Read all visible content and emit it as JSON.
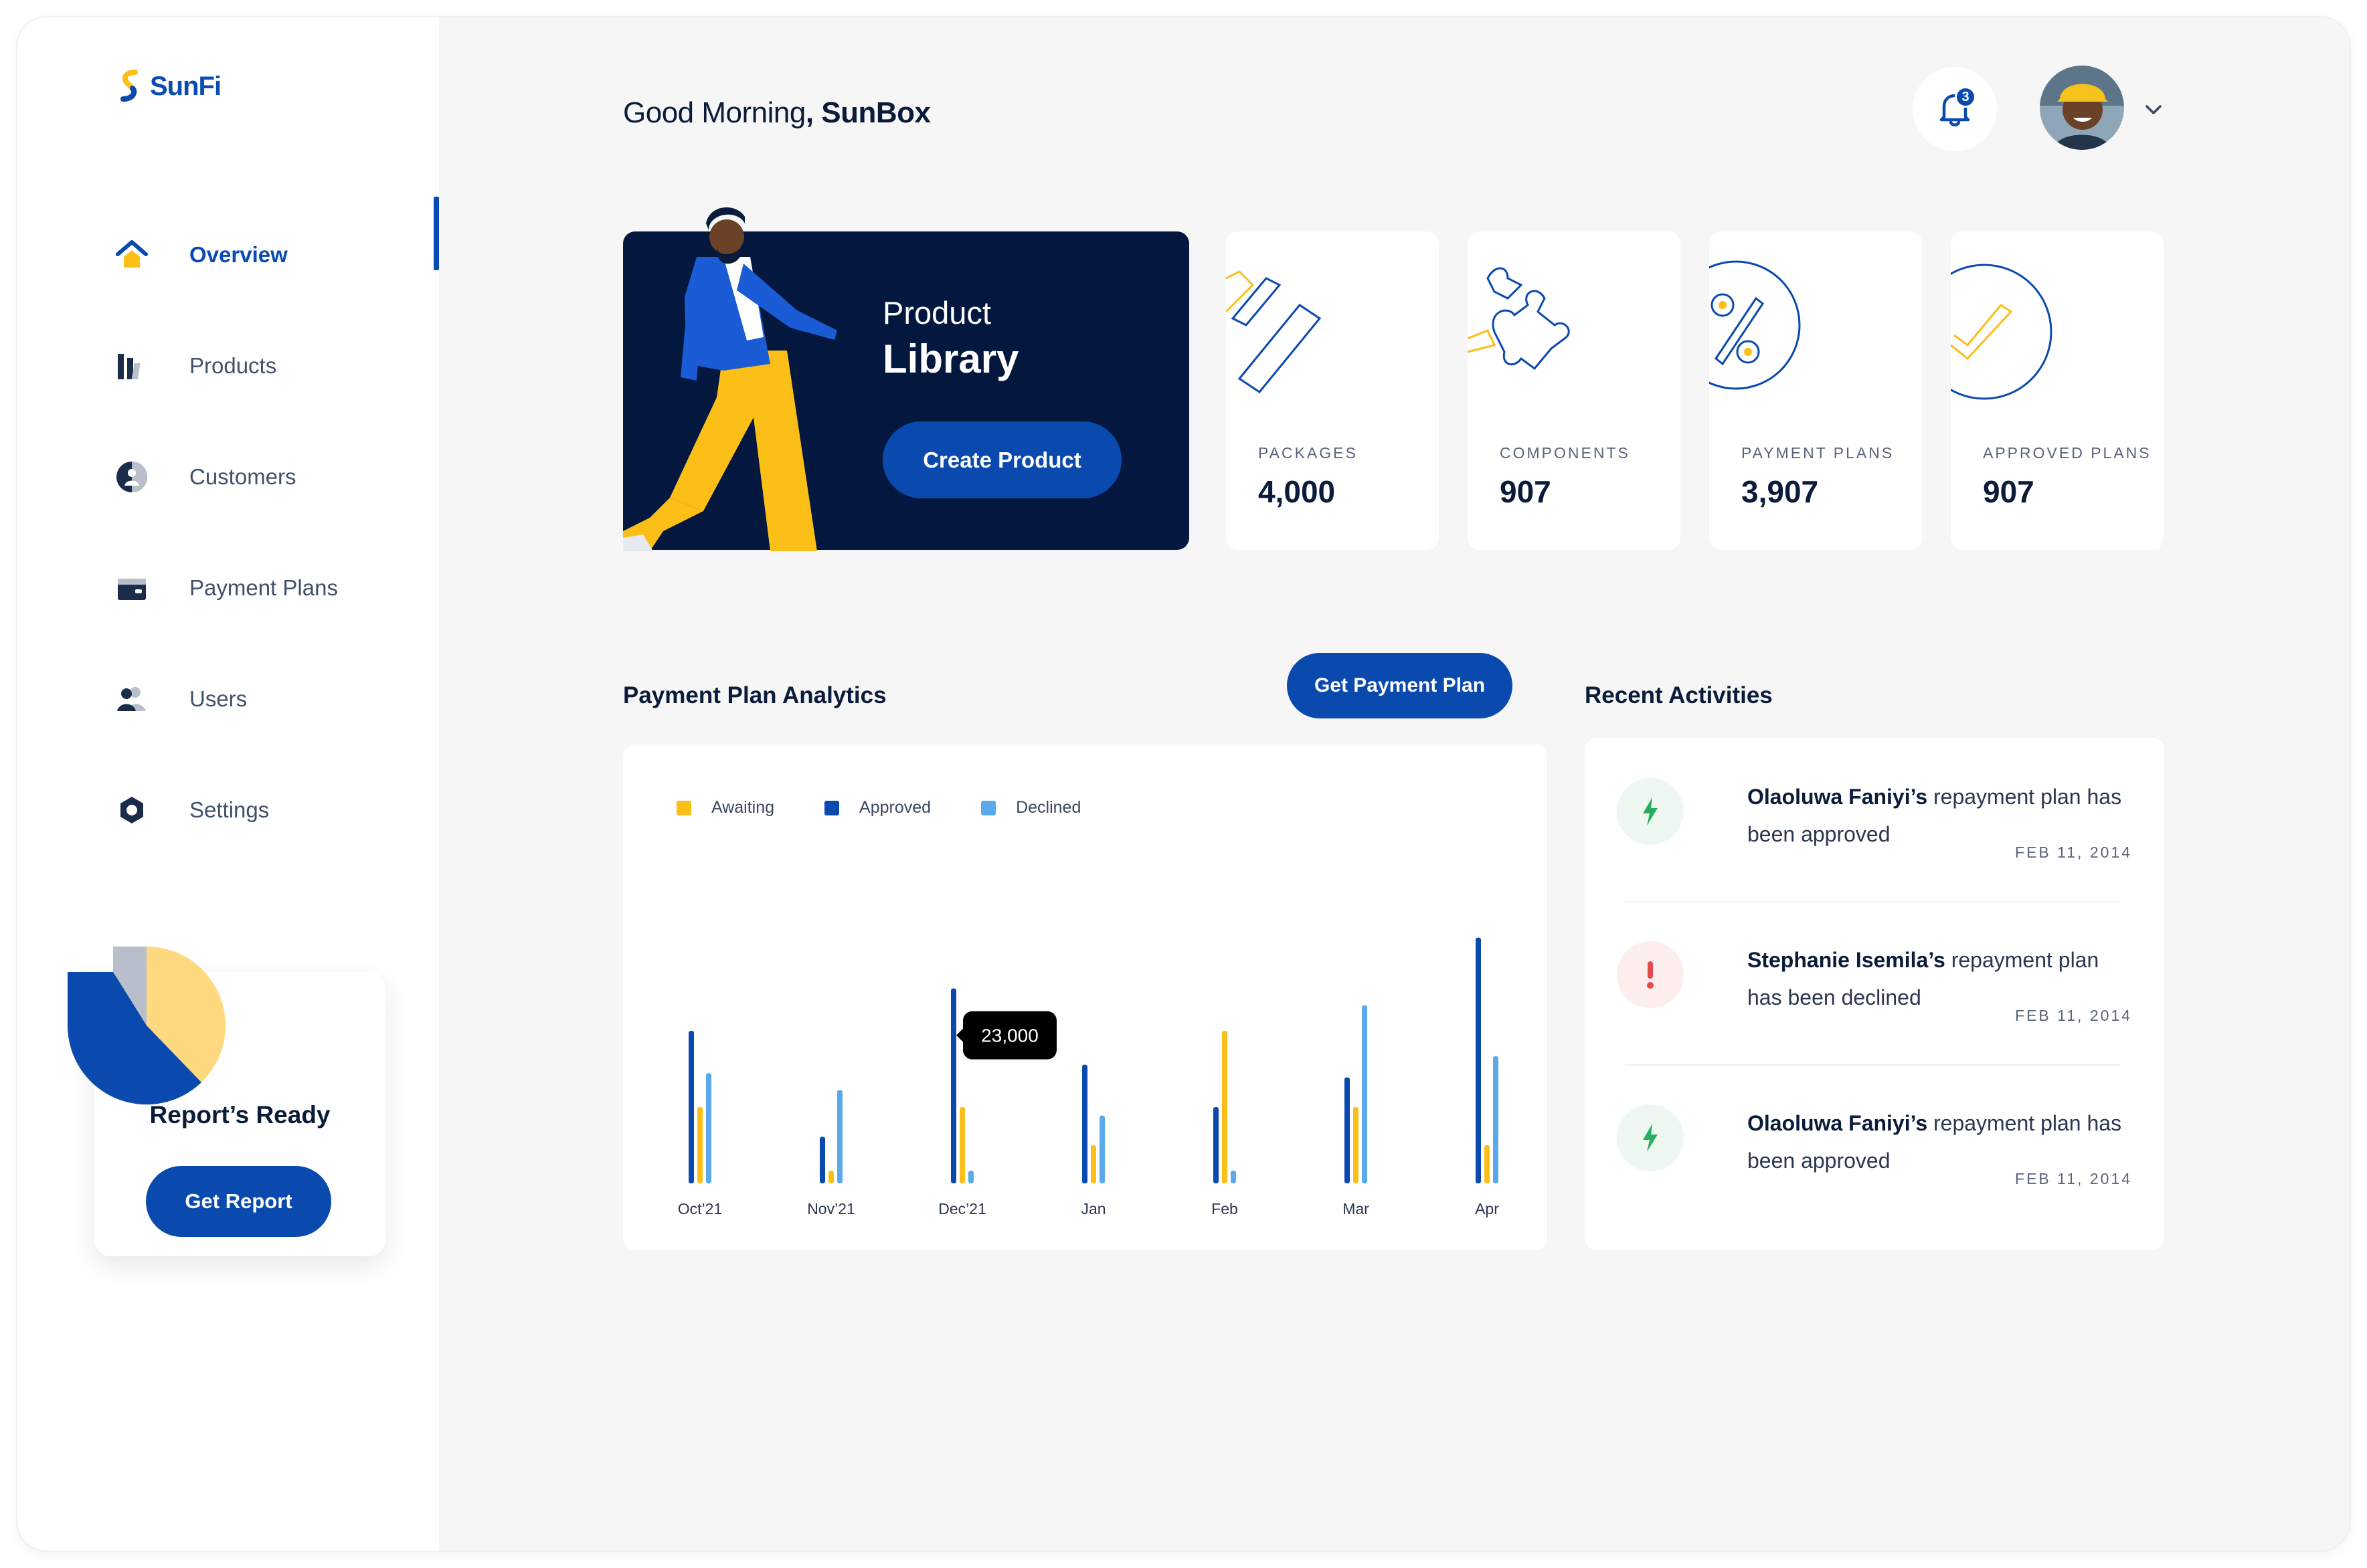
{
  "app": {
    "brand": "SunFi"
  },
  "greeting": {
    "prefix": "Good Morning",
    "name": "SunBox"
  },
  "notifications": {
    "count": "3"
  },
  "sidebar": {
    "items": [
      {
        "label": "Overview",
        "icon": "home-icon",
        "active": true
      },
      {
        "label": "Products",
        "icon": "bar-chart-icon"
      },
      {
        "label": "Customers",
        "icon": "customers-icon"
      },
      {
        "label": "Payment Plans",
        "icon": "wallet-icon"
      },
      {
        "label": "Users",
        "icon": "users-icon"
      },
      {
        "label": "Settings",
        "icon": "gear-icon"
      }
    ]
  },
  "report": {
    "title": "Report’s Ready",
    "button": "Get Report"
  },
  "hero": {
    "subtitle": "Product",
    "title": "Library",
    "button": "Create Product"
  },
  "stats": [
    {
      "label": "PACKAGES",
      "value": "4,000",
      "icon": "package-icon"
    },
    {
      "label": "COMPONENTS",
      "value": "907",
      "icon": "puzzle-icon"
    },
    {
      "label": "PAYMENT PLANS",
      "value": "3,907",
      "icon": "percent-icon"
    },
    {
      "label": "APPROVED PLANS",
      "value": "907",
      "icon": "check-icon"
    }
  ],
  "analytics": {
    "title": "Payment Plan Analytics",
    "button": "Get Payment Plan"
  },
  "activities_section": {
    "title": "Recent Activities"
  },
  "activities": [
    {
      "who": "Olaoluwa Faniyi’s",
      "text": " repayment plan has been approved",
      "date": "FEB 11, 2014",
      "status": "approved",
      "icon": "bolt-icon"
    },
    {
      "who": "Stephanie Isemila’s",
      "text": " repayment plan has been declined",
      "date": "FEB 11, 2014",
      "status": "declined",
      "icon": "exclamation-icon"
    },
    {
      "who": "Olaoluwa Faniyi’s",
      "text": " repayment plan has been approved",
      "date": "FEB 11, 2014",
      "status": "approved",
      "icon": "bolt-icon"
    }
  ],
  "colors": {
    "primary": "#0a49ae",
    "navy": "#04183f",
    "awaiting": "#fbbf18",
    "approved": "#0a49ae",
    "declined": "#5aa9ea",
    "success": "#27ae60",
    "danger": "#e5484d"
  },
  "chart_data": {
    "type": "bar",
    "categories": [
      "Oct’21",
      "Nov’21",
      "Dec’21",
      "Jan",
      "Feb",
      "Mar",
      "Apr"
    ],
    "series": [
      {
        "name": "Awaiting",
        "values": [
          9000,
          1500,
          9000,
          4500,
          18000,
          9000,
          4500
        ]
      },
      {
        "name": "Approved",
        "values": [
          18000,
          5500,
          23000,
          14000,
          9000,
          12500,
          29000
        ]
      },
      {
        "name": "Declined",
        "values": [
          13000,
          11000,
          1500,
          8000,
          1500,
          21000,
          15000
        ]
      }
    ],
    "tooltip": {
      "category": "Dec’21",
      "series": "Approved",
      "label": "23,000"
    },
    "ylim": [
      0,
      30000
    ],
    "legend": "top-left",
    "grid": false
  }
}
